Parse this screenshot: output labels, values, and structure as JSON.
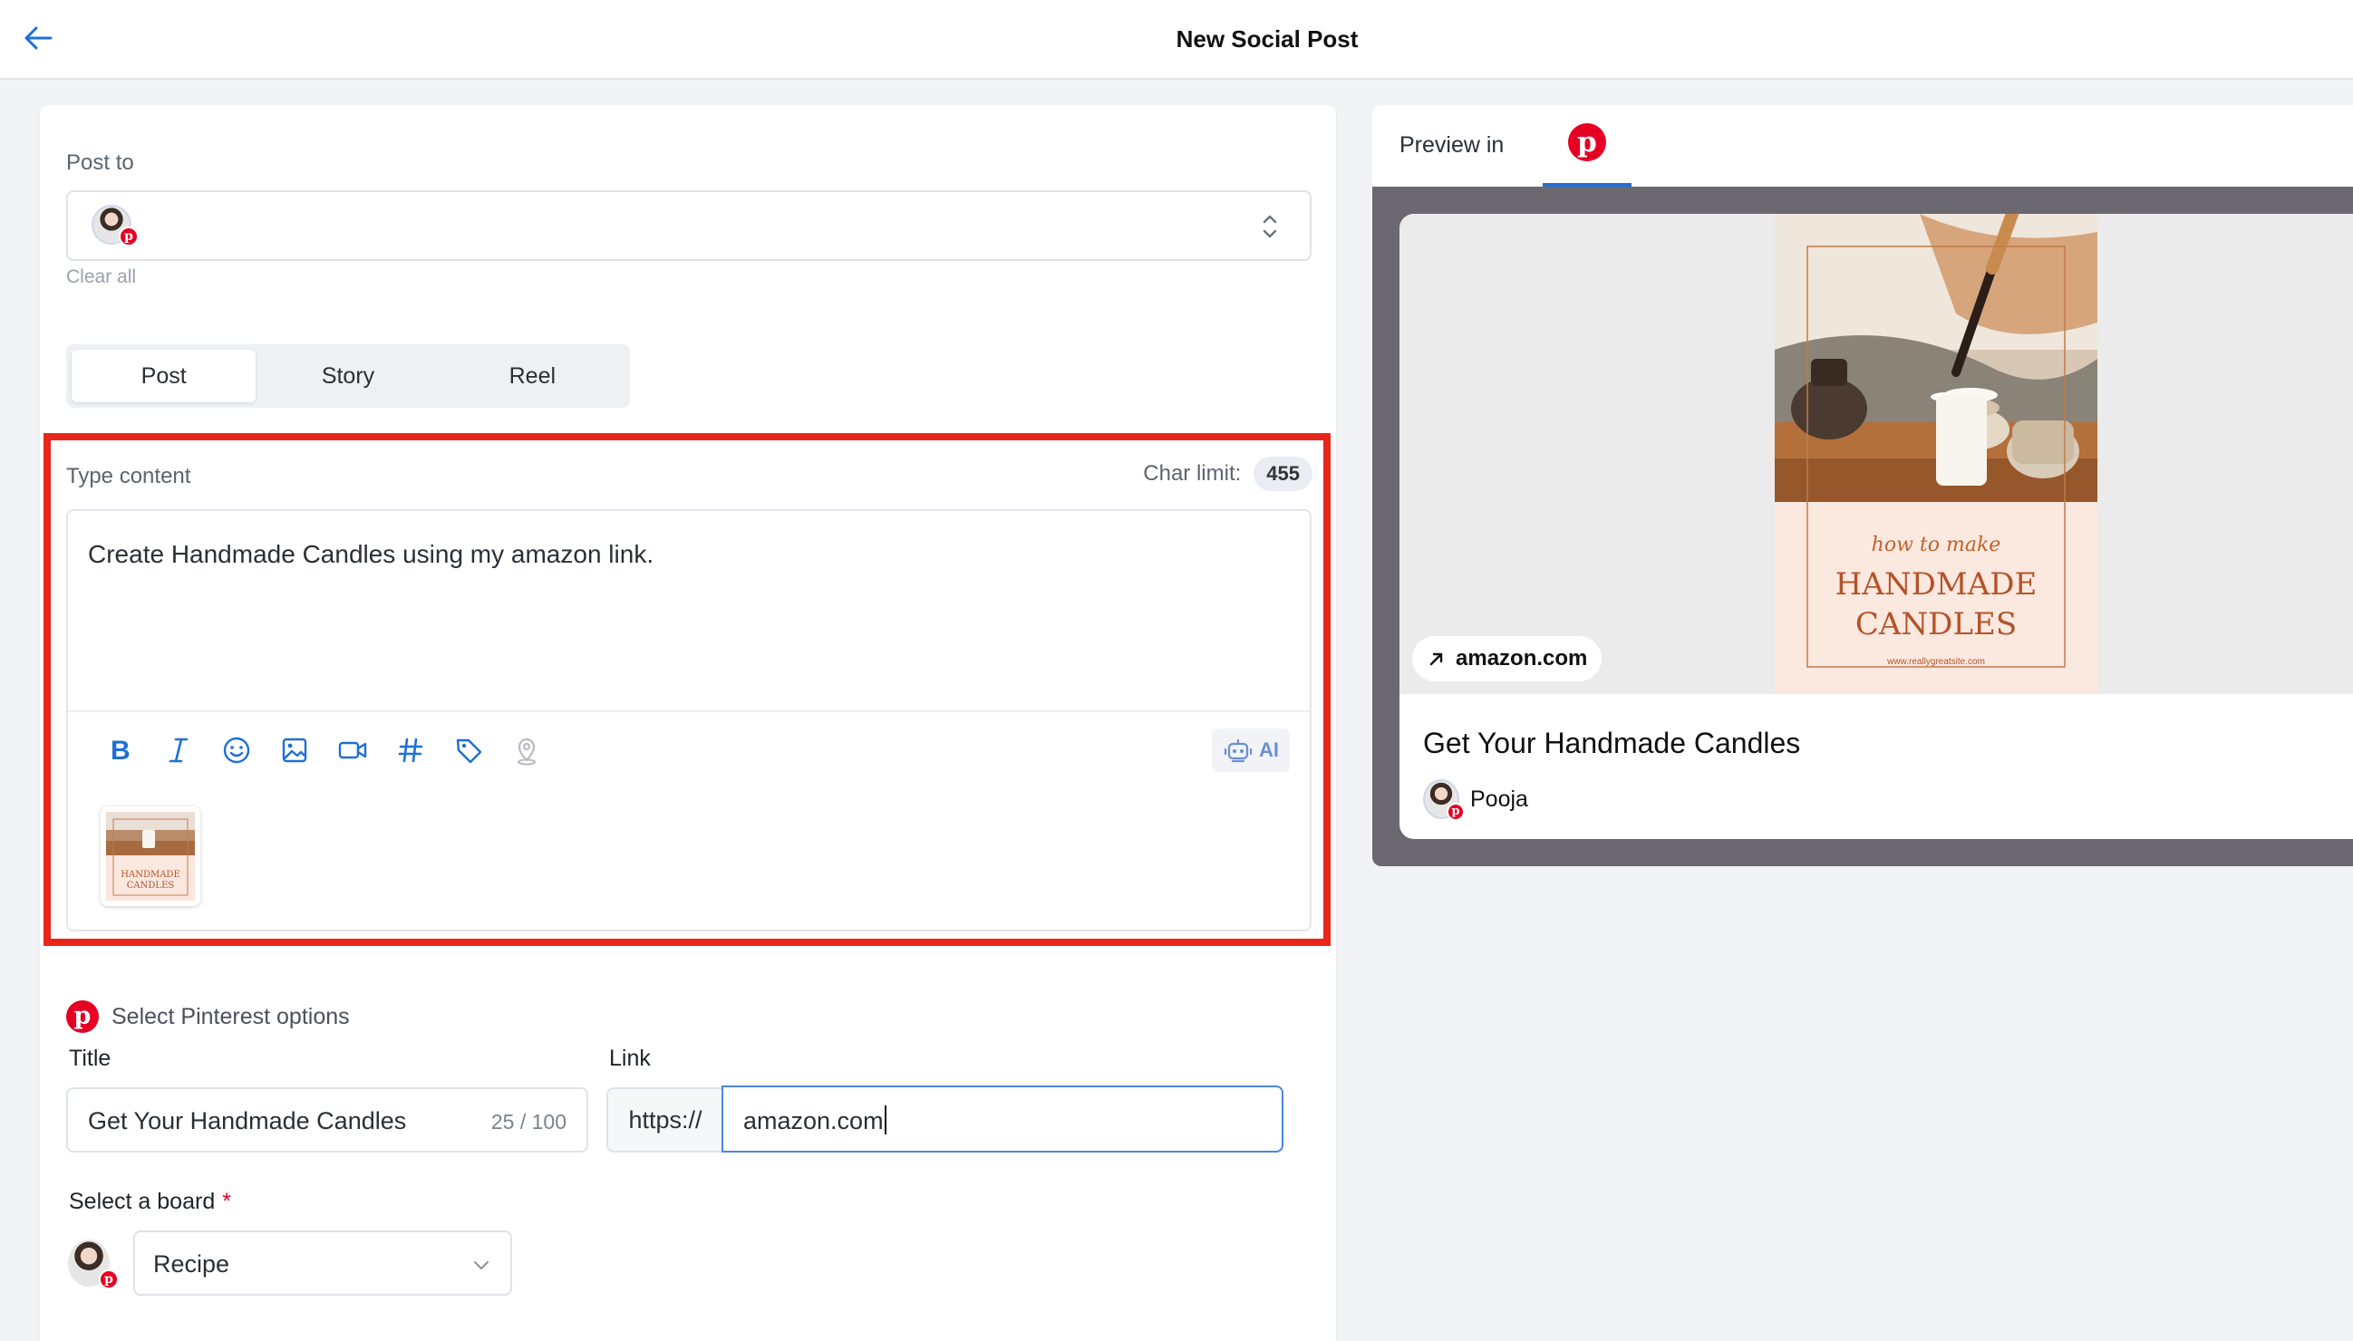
{
  "header": {
    "title": "New Social Post",
    "back_icon": "arrow-left-icon"
  },
  "compose": {
    "post_to_label": "Post to",
    "clear_all": "Clear all",
    "tabs": [
      {
        "label": "Post",
        "active": true
      },
      {
        "label": "Story",
        "active": false
      },
      {
        "label": "Reel",
        "active": false
      }
    ],
    "type_content_label": "Type content",
    "char_limit_label": "Char limit:",
    "char_limit_value": "455",
    "content_text": "Create Handmade Candles using my amazon link.",
    "toolbar_icons": [
      "bold-icon",
      "italic-icon",
      "emoji-icon",
      "image-icon",
      "video-icon",
      "hashtag-icon",
      "tag-icon",
      "location-icon"
    ],
    "ai_label": "AI",
    "highlight_color": "#e8261c"
  },
  "pinterest": {
    "options_label": "Select Pinterest options",
    "title_label": "Title",
    "title_value": "Get Your Handmade Candles",
    "title_count": "25 / 100",
    "link_label": "Link",
    "link_prefix": "https://",
    "link_value": "amazon.com",
    "board_label": "Select a board",
    "board_required": "*",
    "board_value": "Recipe",
    "brand_color": "#e60023"
  },
  "preview": {
    "label": "Preview in",
    "domain": "amazon.com",
    "pin_title": "Get Your Handmade Candles",
    "user_name": "Pooja",
    "image_text_line1": "how to make",
    "image_text_line2": "HANDMADE",
    "image_text_line3": "CANDLES",
    "image_url_text": "www.reallygreatsite.com"
  }
}
